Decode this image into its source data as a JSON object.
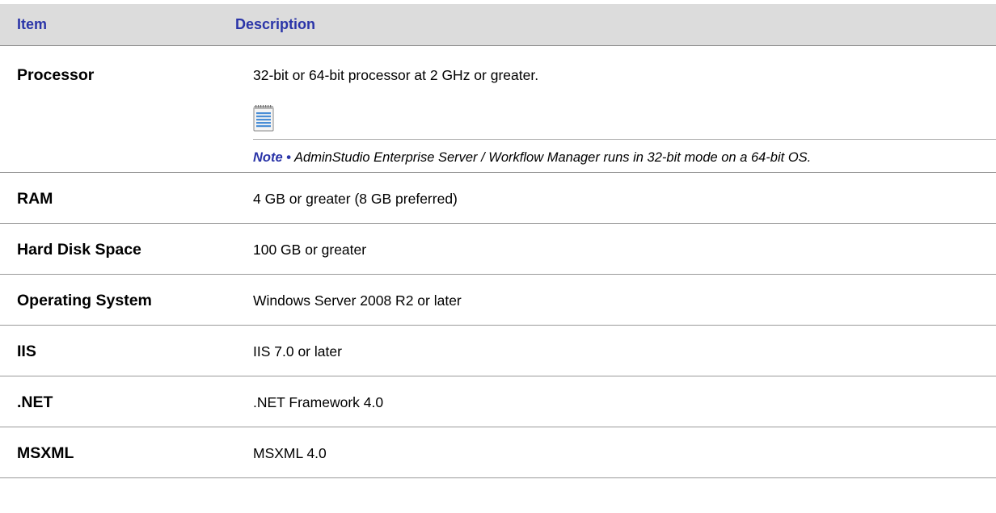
{
  "header": {
    "item": "Item",
    "description": "Description"
  },
  "rows": [
    {
      "item": "Processor",
      "description": "32-bit or 64-bit processor at 2 GHz or greater.",
      "note": {
        "label": "Note",
        "bullet": "•",
        "text": "AdminStudio Enterprise Server / Workflow Manager runs in 32-bit mode on a 64-bit OS."
      }
    },
    {
      "item": "RAM",
      "description": "4 GB or greater (8 GB preferred)"
    },
    {
      "item": "Hard Disk Space",
      "description": "100 GB or greater"
    },
    {
      "item": "Operating System",
      "description": "Windows Server 2008 R2 or later"
    },
    {
      "item": "IIS",
      "description": "IIS 7.0 or later"
    },
    {
      "item": ".NET",
      "description": ".NET Framework 4.0"
    },
    {
      "item": "MSXML",
      "description": "MSXML 4.0"
    }
  ],
  "colors": {
    "header_text": "#2b35a8",
    "header_bg": "#dcdcdc",
    "note_label": "#2b35a8"
  },
  "icons": {
    "note": "notepad-icon"
  }
}
